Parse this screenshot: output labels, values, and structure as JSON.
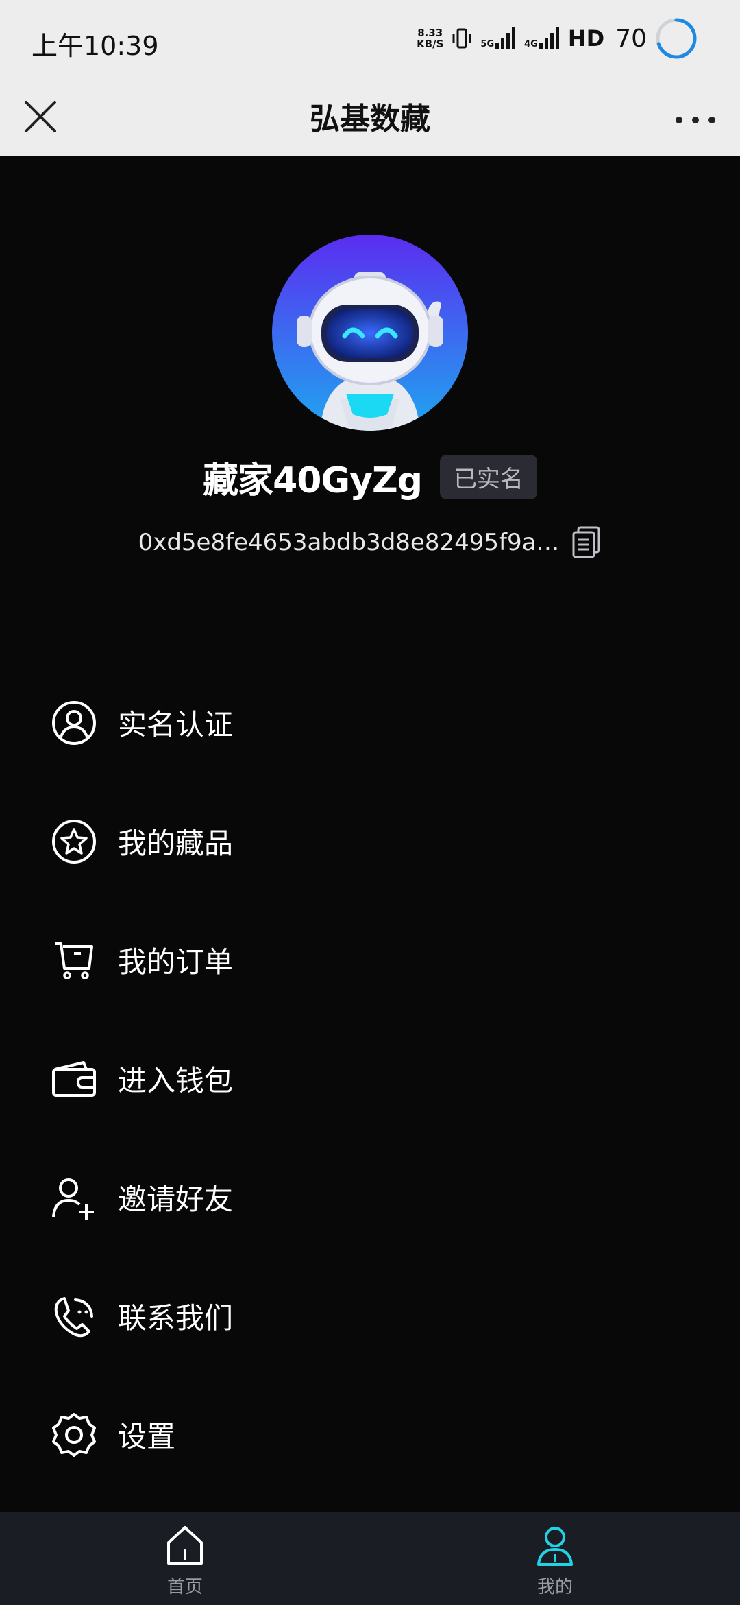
{
  "status_bar": {
    "time": "上午10:39",
    "net_speed_value": "8.33",
    "net_speed_unit": "KB/S",
    "sig1_label": "5G",
    "sig2_label": "4G",
    "hd_label": "HD",
    "battery": "70"
  },
  "title_bar": {
    "title": "弘基数藏",
    "close_icon": "close-icon",
    "more_icon": "more-icon"
  },
  "profile": {
    "username": "藏家40GyZg",
    "verified_badge": "已实名",
    "address": "0xd5e8fe4653abdb3d8e82495f9a…"
  },
  "menu": {
    "items": [
      {
        "label": "实名认证",
        "icon": "user-circle-icon"
      },
      {
        "label": "我的藏品",
        "icon": "star-circle-icon"
      },
      {
        "label": "我的订单",
        "icon": "cart-icon"
      },
      {
        "label": "进入钱包",
        "icon": "wallet-icon"
      },
      {
        "label": "邀请好友",
        "icon": "add-user-icon"
      },
      {
        "label": "联系我们",
        "icon": "phone-icon"
      },
      {
        "label": "设置",
        "icon": "gear-icon"
      }
    ]
  },
  "bottom_nav": {
    "items": [
      {
        "label": "首页",
        "icon": "home-icon",
        "active": false
      },
      {
        "label": "我的",
        "icon": "profile-icon",
        "active": true
      }
    ]
  },
  "colors": {
    "background": "#080809",
    "nav_background": "#1b1d25",
    "accent": "#22d3e6",
    "badge_bg": "#2a2b33"
  }
}
